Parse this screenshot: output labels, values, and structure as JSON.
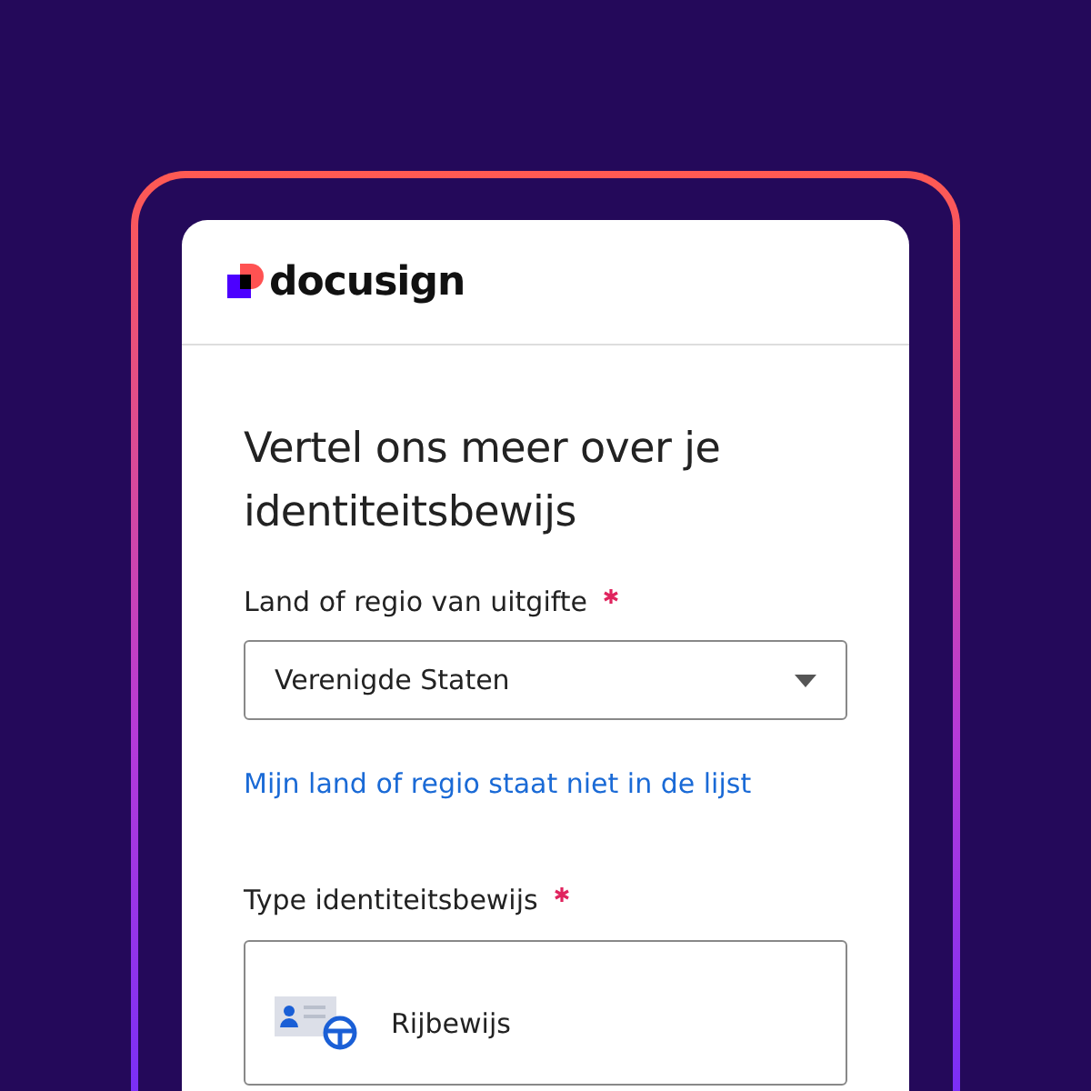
{
  "header": {
    "logo_text": "docusign"
  },
  "form": {
    "title": "Vertel ons meer over je identiteitsbewijs",
    "country": {
      "label": "Land of regio van uitgifte",
      "required": true,
      "value": "Verenigde Staten"
    },
    "link": "Mijn land of regio staat niet in de lijst",
    "id_type": {
      "label": "Type identiteitsbewijs",
      "required": true,
      "options": [
        {
          "label": "Rijbewijs",
          "kind": "drivers-license"
        }
      ]
    }
  }
}
